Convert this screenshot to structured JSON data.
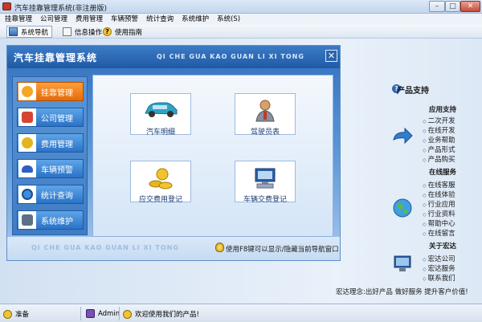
{
  "window": {
    "title": "汽车挂靠管理系统(非注册版)",
    "min": "–",
    "max": "□",
    "close": "✕"
  },
  "menu": [
    "挂靠管理",
    "公司管理",
    "费用管理",
    "车辆预警",
    "统计查询",
    "系统维护",
    "系统(S)"
  ],
  "toolbar": {
    "nav": "系统导航",
    "info": "信息操作",
    "help": "使用指南"
  },
  "nav": {
    "title": "汽车挂靠管理系统",
    "pinyin": "QI CHE GUA KAO GUAN LI XI TONG",
    "close": "✕",
    "left_items": [
      {
        "label": "挂靠管理",
        "icon": "person-icon",
        "active": true,
        "color": "#f5a623"
      },
      {
        "label": "公司管理",
        "icon": "house-icon",
        "active": false,
        "color": "#d64533"
      },
      {
        "label": "费用管理",
        "icon": "coins-icon",
        "active": false,
        "color": "#e1b522"
      },
      {
        "label": "车辆预警",
        "icon": "car-icon",
        "active": false,
        "color": "#2f5fc4"
      },
      {
        "label": "统计查询",
        "icon": "magnifier-icon",
        "active": false,
        "color": "#3a8de0"
      },
      {
        "label": "系统维护",
        "icon": "monitor-icon",
        "active": false,
        "color": "#5c6f89"
      }
    ],
    "tiles": [
      {
        "label": "汽车明细",
        "icon": "car-icon"
      },
      {
        "label": "驾驶员表",
        "icon": "driver-icon"
      },
      {
        "label": "应交费用登记",
        "icon": "money-icon"
      },
      {
        "label": "车辆交费登记",
        "icon": "computer-icon"
      }
    ],
    "footer_watermark": "QI CHE GUA KAO GUAN LI XI TONG",
    "footer_tip": "使用F8键可以显示/隐藏当前导航窗口"
  },
  "support": {
    "title": "产品支持",
    "sections": [
      {
        "title": "应用支持",
        "links": [
          "二次开发",
          "在线开发",
          "业务帮助",
          "产品形式",
          "产品购买"
        ]
      },
      {
        "title": "在线服务",
        "links": [
          "在线客服",
          "在线体验",
          "行业应用",
          "行业资料",
          "帮助中心",
          "在线留言"
        ]
      },
      {
        "title": "关于宏达",
        "links": [
          "宏达公司",
          "宏达服务",
          "联系我们"
        ]
      }
    ],
    "motto": "宏达理念:出好产品 做好服务 提升客户价值!"
  },
  "status": {
    "state": "准备",
    "user": "Admin",
    "welcome": "欢迎使用我们的产品!"
  }
}
